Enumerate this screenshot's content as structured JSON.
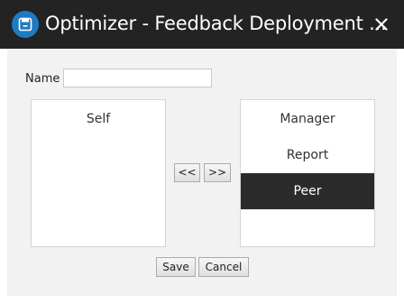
{
  "window": {
    "title": "Optimizer - Feedback Deployment ...",
    "app_icon": "app-window-icon",
    "close_icon": "close-icon"
  },
  "form": {
    "name_label": "Name",
    "name_value": "",
    "name_placeholder": ""
  },
  "left_list": {
    "items": [
      {
        "label": "Self",
        "selected": false
      }
    ]
  },
  "right_list": {
    "items": [
      {
        "label": "Manager",
        "selected": false
      },
      {
        "label": "Report",
        "selected": false
      },
      {
        "label": "Peer",
        "selected": true
      }
    ]
  },
  "buttons": {
    "move_left": "<<",
    "move_right": ">>",
    "save": "Save",
    "cancel": "Cancel"
  },
  "colors": {
    "titlebar": "#232323",
    "accent": "#1f7bc1",
    "selected_item": "#2b2b2b",
    "panel": "#f2f2f2"
  }
}
